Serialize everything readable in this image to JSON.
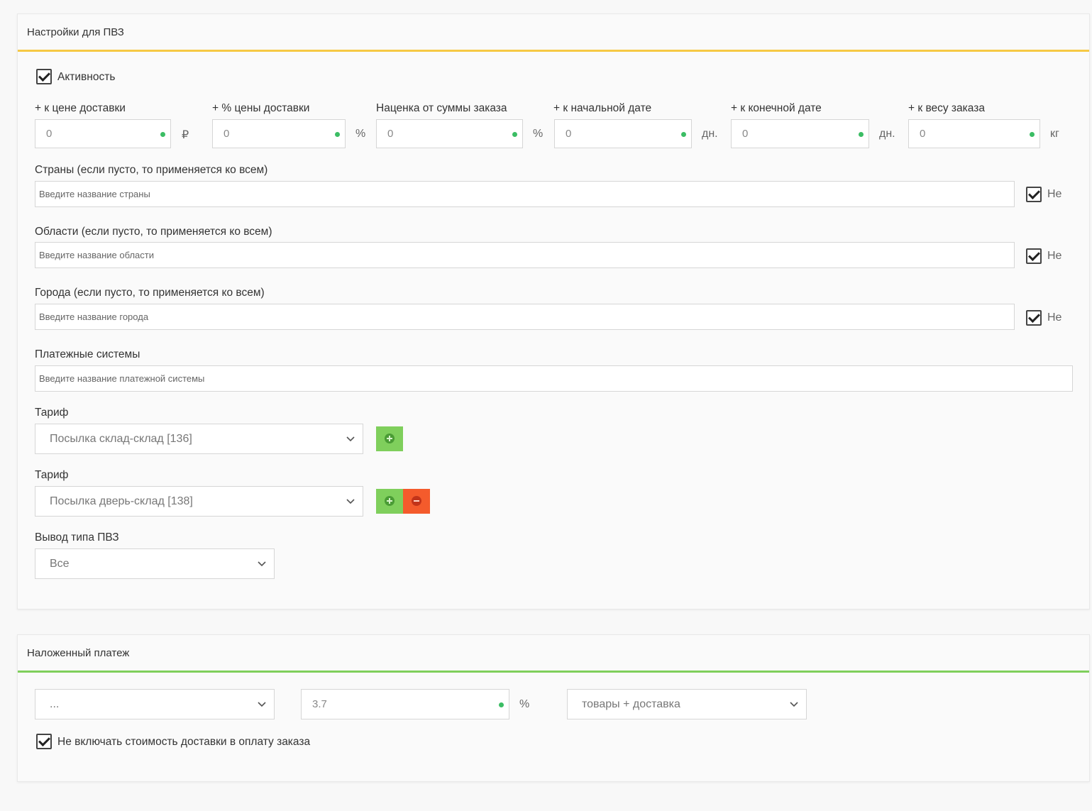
{
  "pvz_panel": {
    "title": "Настройки для ПВЗ",
    "active_label": "Активность",
    "fields": [
      {
        "label": "+ к цене доставки",
        "value": "0",
        "unit": "₽"
      },
      {
        "label": "+ % цены доставки",
        "value": "0",
        "unit": "%"
      },
      {
        "label": "Наценка от суммы заказа",
        "value": "0",
        "unit": "%"
      },
      {
        "label": "+ к начальной дате",
        "value": "0",
        "unit": "дн."
      },
      {
        "label": "+ к конечной дате",
        "value": "0",
        "unit": "дн."
      },
      {
        "label": "+ к весу заказа",
        "value": "0",
        "unit": "кг"
      }
    ],
    "countries": {
      "label": "Страны (если пусто, то применяется ко всем)",
      "placeholder": "Введите название страны",
      "not_label": "Не"
    },
    "regions": {
      "label": "Области (если пусто, то применяется ко всем)",
      "placeholder": "Введите название области",
      "not_label": "Не"
    },
    "cities": {
      "label": "Города (если пусто, то применяется ко всем)",
      "placeholder": "Введите название города",
      "not_label": "Не"
    },
    "payments": {
      "label": "Платежные системы",
      "placeholder": "Введите название платежной системы"
    },
    "tariffs": [
      {
        "label": "Тариф",
        "value": "Посылка склад-склад [136]"
      },
      {
        "label": "Тариф",
        "value": "Посылка дверь-склад [138]"
      }
    ],
    "pvz_type": {
      "label": "Вывод типа ПВЗ",
      "value": "Все"
    }
  },
  "cod_panel": {
    "title": "Наложенный платеж",
    "select_value": "...",
    "percent_value": "3.7",
    "percent_unit": "%",
    "base_value": "товары + доставка",
    "exclude_label": "Не включать стоимость доставки в оплату заказа"
  },
  "colors": {
    "accent_yellow": "#f6c945",
    "accent_green": "#7fcf5c",
    "button_green": "#7fcf5c",
    "button_red": "#f45b2c",
    "dot_green": "#3bbd64"
  },
  "icons": {
    "checkbox": "check-icon",
    "select": "chevron-down-icon",
    "add": "plus-circle-icon",
    "remove": "minus-circle-icon"
  }
}
